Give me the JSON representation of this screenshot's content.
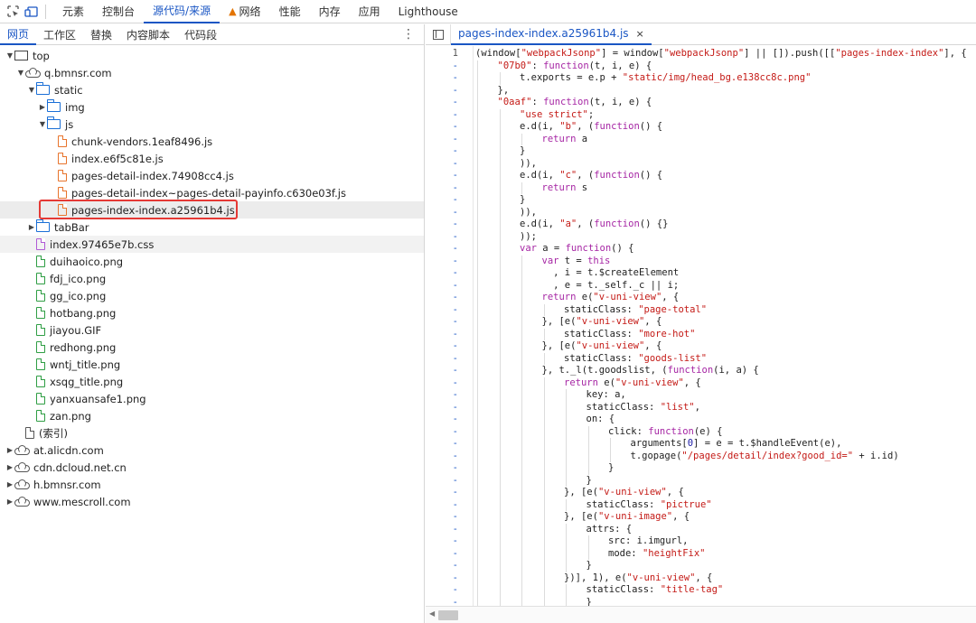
{
  "topbar": {
    "tabs": [
      "元素",
      "控制台",
      "源代码/来源",
      "网络",
      "性能",
      "内存",
      "应用",
      "Lighthouse"
    ],
    "active_tab": "源代码/来源"
  },
  "navigator": {
    "tabs": [
      "网页",
      "工作区",
      "替换",
      "内容脚本",
      "代码段"
    ],
    "active_tab": "网页",
    "tree": [
      {
        "label": "top",
        "type": "frame",
        "depth": 0,
        "expanded": true
      },
      {
        "label": "q.bmnsr.com",
        "type": "domain",
        "depth": 1,
        "expanded": true
      },
      {
        "label": "static",
        "type": "folder",
        "depth": 2,
        "expanded": true
      },
      {
        "label": "img",
        "type": "folder",
        "depth": 3,
        "expanded": false
      },
      {
        "label": "js",
        "type": "folder",
        "depth": 3,
        "expanded": true
      },
      {
        "label": "chunk-vendors.1eaf8496.js",
        "type": "js",
        "depth": 4
      },
      {
        "label": "index.e6f5c81e.js",
        "type": "js",
        "depth": 4
      },
      {
        "label": "pages-detail-index.74908cc4.js",
        "type": "js",
        "depth": 4
      },
      {
        "label": "pages-detail-index~pages-detail-payinfo.c630e03f.js",
        "type": "js",
        "depth": 4
      },
      {
        "label": "pages-index-index.a25961b4.js",
        "type": "js",
        "depth": 4,
        "selected": true
      },
      {
        "label": "tabBar",
        "type": "folder",
        "depth": 2,
        "expanded": false
      },
      {
        "label": "index.97465e7b.css",
        "type": "css",
        "depth": 2
      },
      {
        "label": "duihaoico.png",
        "type": "img",
        "depth": 2
      },
      {
        "label": "fdj_ico.png",
        "type": "img",
        "depth": 2
      },
      {
        "label": "gg_ico.png",
        "type": "img",
        "depth": 2
      },
      {
        "label": "hotbang.png",
        "type": "img",
        "depth": 2
      },
      {
        "label": "jiayou.GIF",
        "type": "img",
        "depth": 2
      },
      {
        "label": "redhong.png",
        "type": "img",
        "depth": 2
      },
      {
        "label": "wntj_title.png",
        "type": "img",
        "depth": 2
      },
      {
        "label": "xsqg_title.png",
        "type": "img",
        "depth": 2
      },
      {
        "label": "yanxuansafe1.png",
        "type": "img",
        "depth": 2
      },
      {
        "label": "zan.png",
        "type": "img",
        "depth": 2
      },
      {
        "label": "(索引)",
        "type": "doc",
        "depth": 1
      },
      {
        "label": "at.alicdn.com",
        "type": "domain",
        "depth": 0,
        "expanded": false
      },
      {
        "label": "cdn.dcloud.net.cn",
        "type": "domain",
        "depth": 0,
        "expanded": false
      },
      {
        "label": "h.bmnsr.com",
        "type": "domain",
        "depth": 0,
        "expanded": false
      },
      {
        "label": "www.mescroll.com",
        "type": "domain",
        "depth": 0,
        "expanded": false
      }
    ]
  },
  "editor": {
    "open_file": "pages-index-index.a25961b4.js",
    "close_glyph": "×",
    "lines": [
      {
        "n": "1",
        "indent": 0,
        "html": "(window[<s>\"webpackJsonp\"</s>] = window[<s>\"webpackJsonp\"</s>] || []).push([[<s>\"pages-index-index\"</s>], {"
      },
      {
        "n": "-",
        "indent": 1,
        "html": "<s>\"07b0\"</s>: <k>function</k>(t, i, e) {"
      },
      {
        "n": "-",
        "indent": 2,
        "html": "t.exports = e.p + <s>\"static/img/head_bg.e138cc8c.png\"</s>"
      },
      {
        "n": "-",
        "indent": 1,
        "html": "},"
      },
      {
        "n": "-",
        "indent": 1,
        "html": "<s>\"0aaf\"</s>: <k>function</k>(t, i, e) {"
      },
      {
        "n": "-",
        "indent": 2,
        "html": "<s>\"use strict\"</s>;"
      },
      {
        "n": "-",
        "indent": 2,
        "html": "e.d(i, <s>\"b\"</s>, (<k>function</k>() {"
      },
      {
        "n": "-",
        "indent": 3,
        "html": "<k>return</k> a"
      },
      {
        "n": "-",
        "indent": 2,
        "html": "}"
      },
      {
        "n": "-",
        "indent": 2,
        "html": ")),"
      },
      {
        "n": "-",
        "indent": 2,
        "html": "e.d(i, <s>\"c\"</s>, (<k>function</k>() {"
      },
      {
        "n": "-",
        "indent": 3,
        "html": "<k>return</k> s"
      },
      {
        "n": "-",
        "indent": 2,
        "html": "}"
      },
      {
        "n": "-",
        "indent": 2,
        "html": ")),"
      },
      {
        "n": "-",
        "indent": 2,
        "html": "e.d(i, <s>\"a\"</s>, (<k>function</k>() {}"
      },
      {
        "n": "-",
        "indent": 2,
        "html": "));"
      },
      {
        "n": "-",
        "indent": 2,
        "html": "<k>var</k> a = <k>function</k>() {"
      },
      {
        "n": "-",
        "indent": 3,
        "html": "<k>var</k> t = <k>this</k>"
      },
      {
        "n": "-",
        "indent": 3,
        "html": "  , i = t.$createElement"
      },
      {
        "n": "-",
        "indent": 3,
        "html": "  , e = t._self._c || i;"
      },
      {
        "n": "-",
        "indent": 3,
        "html": "<k>return</k> e(<s>\"v-uni-view\"</s>, {"
      },
      {
        "n": "-",
        "indent": 4,
        "html": "staticClass: <s>\"page-total\"</s>"
      },
      {
        "n": "-",
        "indent": 3,
        "html": "}, [e(<s>\"v-uni-view\"</s>, {"
      },
      {
        "n": "-",
        "indent": 4,
        "html": "staticClass: <s>\"more-hot\"</s>"
      },
      {
        "n": "-",
        "indent": 3,
        "html": "}, [e(<s>\"v-uni-view\"</s>, {"
      },
      {
        "n": "-",
        "indent": 4,
        "html": "staticClass: <s>\"goods-list\"</s>"
      },
      {
        "n": "-",
        "indent": 3,
        "html": "}, t._l(t.goodslist, (<k>function</k>(i, a) {"
      },
      {
        "n": "-",
        "indent": 4,
        "html": "<k>return</k> e(<s>\"v-uni-view\"</s>, {"
      },
      {
        "n": "-",
        "indent": 5,
        "html": "key: a,"
      },
      {
        "n": "-",
        "indent": 5,
        "html": "staticClass: <s>\"list\"</s>,"
      },
      {
        "n": "-",
        "indent": 5,
        "html": "on: {"
      },
      {
        "n": "-",
        "indent": 6,
        "html": "click: <k>function</k>(e) {"
      },
      {
        "n": "-",
        "indent": 7,
        "html": "arguments[<b>0</b>] = e = t.$handleEvent(e),"
      },
      {
        "n": "-",
        "indent": 7,
        "html": "t.gopage(<s>\"/pages/detail/index?good_id=\"</s> + i.id)"
      },
      {
        "n": "-",
        "indent": 6,
        "html": "}"
      },
      {
        "n": "-",
        "indent": 5,
        "html": "}"
      },
      {
        "n": "-",
        "indent": 4,
        "html": "}, [e(<s>\"v-uni-view\"</s>, {"
      },
      {
        "n": "-",
        "indent": 5,
        "html": "staticClass: <s>\"pictrue\"</s>"
      },
      {
        "n": "-",
        "indent": 4,
        "html": "}, [e(<s>\"v-uni-image\"</s>, {"
      },
      {
        "n": "-",
        "indent": 5,
        "html": "attrs: {"
      },
      {
        "n": "-",
        "indent": 6,
        "html": "src: i.imgurl,"
      },
      {
        "n": "-",
        "indent": 6,
        "html": "mode: <s>\"heightFix\"</s>"
      },
      {
        "n": "-",
        "indent": 5,
        "html": "}"
      },
      {
        "n": "-",
        "indent": 4,
        "html": "})], 1), e(<s>\"v-uni-view\"</s>, {"
      },
      {
        "n": "-",
        "indent": 5,
        "html": "staticClass: <s>\"title-tag\"</s>"
      },
      {
        "n": "-",
        "indent": 5,
        "html": "}"
      }
    ]
  }
}
